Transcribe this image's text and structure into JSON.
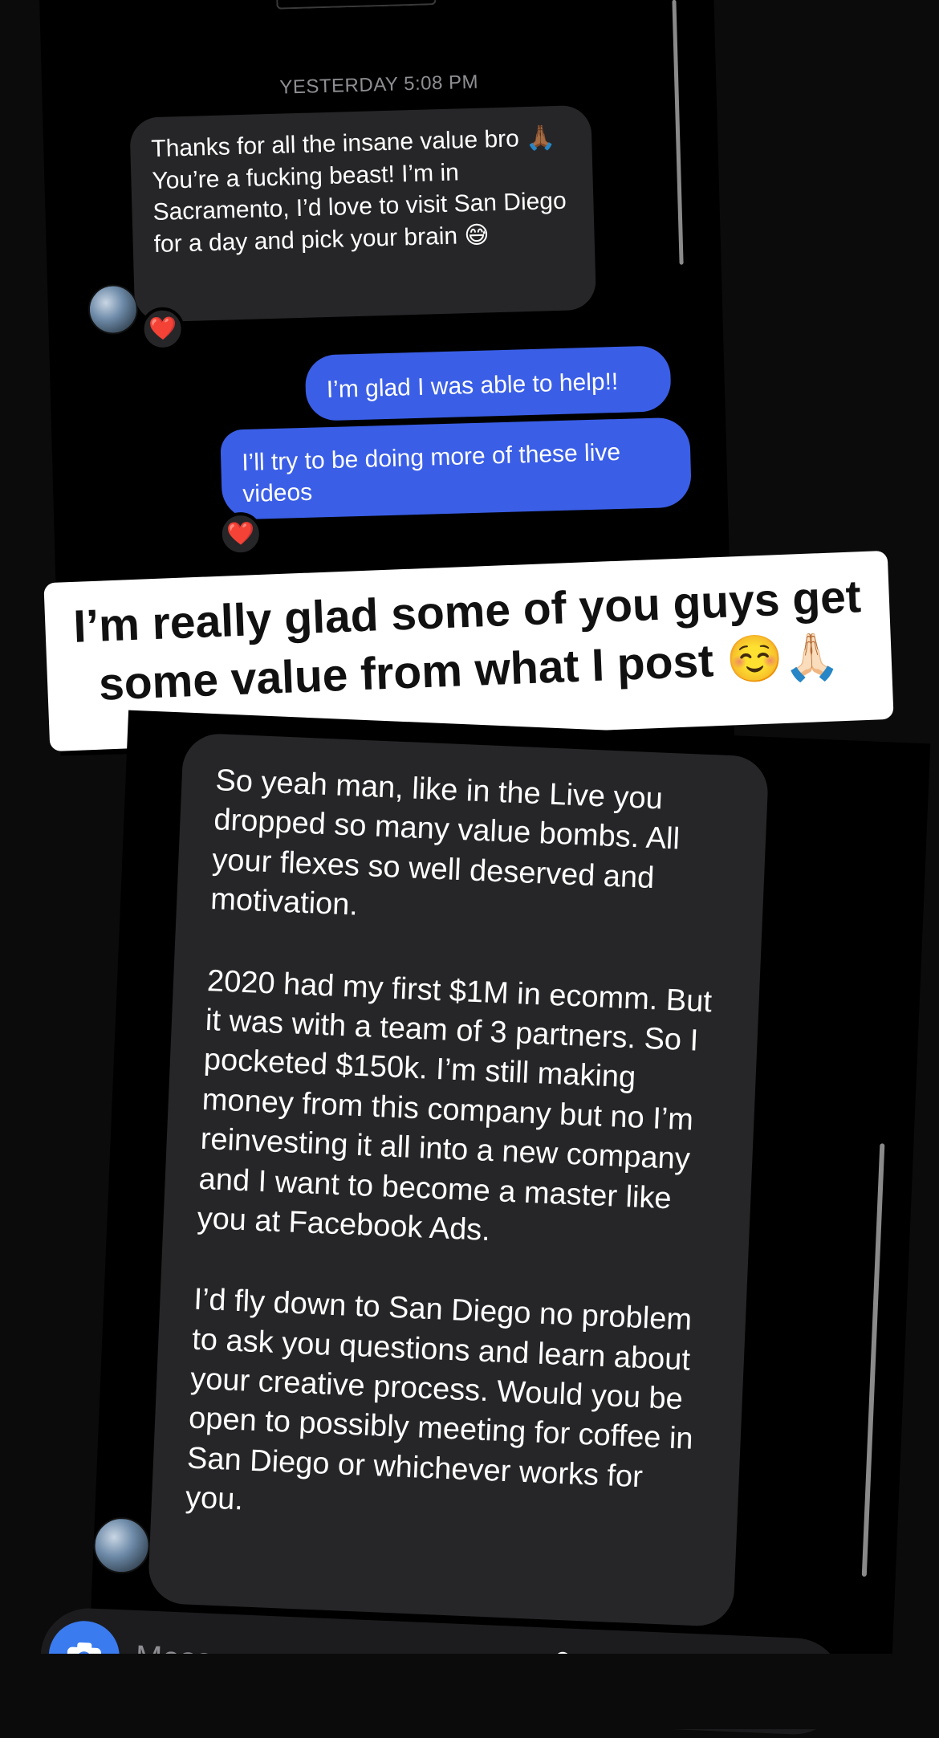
{
  "conversation_top": {
    "timestamp": "YESTERDAY 5:08 PM",
    "incoming_message": "Thanks for all the insane value bro 🙏🏾 You’re a fucking beast! I’m in Sacramento, I’d love to visit San Diego for a day and pick your brain 😅",
    "incoming_reaction": "❤️",
    "outgoing_messages": [
      "I’m glad I was able to help!!",
      "I’ll try to be doing more of these live videos"
    ],
    "outgoing_reaction": "❤️"
  },
  "caption": {
    "text": "I’m really glad some of you guys get some value from what I post",
    "emoji": "☺️🙏🏻"
  },
  "conversation_bottom": {
    "paragraphs": [
      "So yeah man, like in the Live you dropped so many value bombs. All your flexes so well deserved and motivation.",
      "2020 had my first $1M in ecomm. But it was with a team of 3 partners. So I pocketed $150k. I’m still making money from this company but no I’m reinvesting it all into a new company and I want to become a master like you at Facebook Ads.",
      "I’d fly down to San Diego no problem to ask you questions and learn about your creative process. Would you be open to possibly meeting for coffee in San Diego or whichever works for you."
    ],
    "composer": {
      "placeholder": "Message...",
      "camera_icon": "camera-icon",
      "mic_icon": "microphone-icon",
      "gallery_icon": "gallery-icon",
      "add_icon": "plus-icon"
    }
  },
  "colors": {
    "background": "#000000",
    "incoming_bubble": "#262628",
    "outgoing_bubble": "#3a5ee6",
    "timestamp": "#8e8e93",
    "heart": "#e8262e"
  }
}
